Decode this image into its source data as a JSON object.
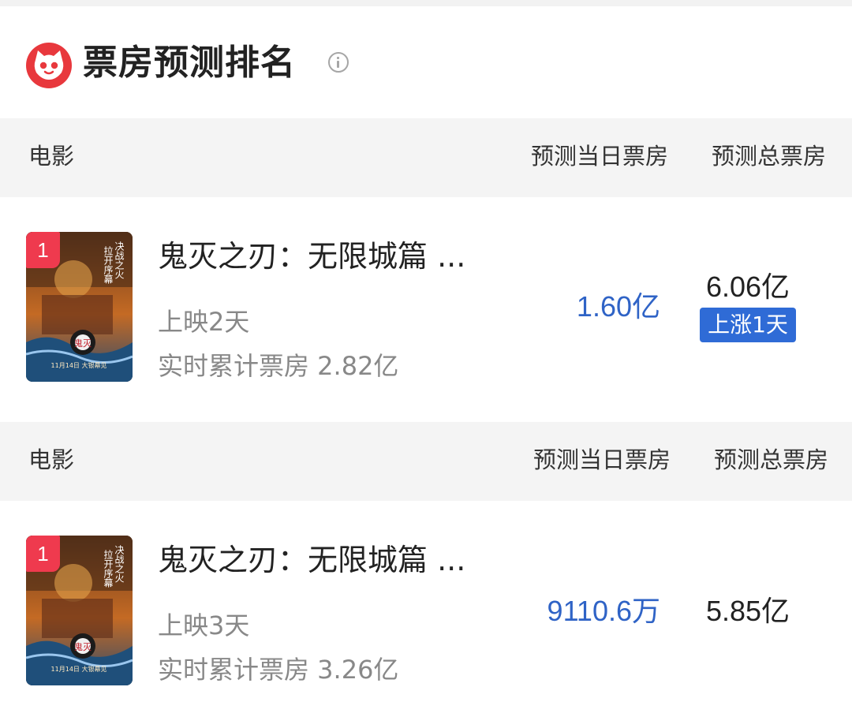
{
  "header": {
    "title": "票房预测排名",
    "info_icon": "info-circle-icon",
    "logo_icon": "maoyan-cat-logo-icon"
  },
  "columns": {
    "movie": "电影",
    "day": "预测当日票房",
    "total": "预测总票房"
  },
  "rows": [
    {
      "rank": "1",
      "title": "鬼灭之刃：无限城篇 ...",
      "run": "上映2天",
      "cumulative": "实时累计票房 2.82亿",
      "day_box_office": "1.60亿",
      "total_box_office": "6.06亿",
      "badge": "上涨1天"
    },
    {
      "rank": "1",
      "title": "鬼灭之刃：无限城篇 ...",
      "run": "上映3天",
      "cumulative": "实时累计票房 3.26亿",
      "day_box_office": "9110.6万",
      "total_box_office": "5.85亿"
    }
  ],
  "poster": {
    "tagline": [
      "决战之火",
      "拉开序幕"
    ],
    "logo_text": "鬼灭",
    "date_text": "11月14日 大银幕见"
  },
  "colors": {
    "accent_red": "#ef3a4e",
    "value_blue": "#2f63c6",
    "badge_blue": "#2f6bd6"
  }
}
